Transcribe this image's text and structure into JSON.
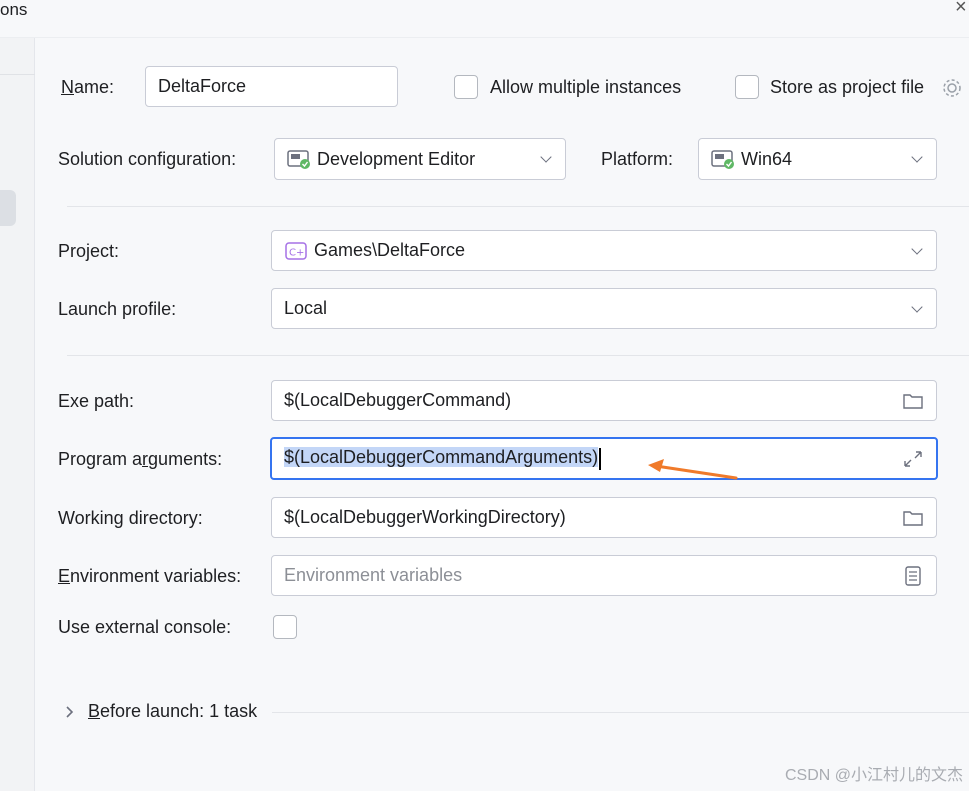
{
  "window": {
    "title_fragment": "ons"
  },
  "name": {
    "label": "Name:",
    "value": "DeltaForce"
  },
  "allow_multiple": {
    "label": "Allow multiple instances",
    "checked": false
  },
  "store_project": {
    "label": "Store as project file",
    "checked": false
  },
  "solution_config": {
    "label": "Solution configuration:",
    "value": "Development Editor"
  },
  "platform": {
    "label": "Platform:",
    "value": "Win64"
  },
  "project": {
    "label": "Project:",
    "value": "Games\\DeltaForce"
  },
  "launch_profile": {
    "label": "Launch profile:",
    "value": "Local"
  },
  "exe_path": {
    "label": "Exe path:",
    "value": "$(LocalDebuggerCommand)"
  },
  "program_args": {
    "label": "Program arguments:",
    "value": "$(LocalDebuggerCommandArguments)"
  },
  "working_dir": {
    "label": "Working directory:",
    "value": "$(LocalDebuggerWorkingDirectory)"
  },
  "env_vars": {
    "label": "Environment variables:",
    "placeholder": "Environment variables"
  },
  "external_console": {
    "label": "Use external console:",
    "checked": false
  },
  "before_launch": {
    "label": "Before launch: 1 task"
  },
  "watermark": "CSDN @小江村儿的文杰",
  "colors": {
    "accent": "#3574f0",
    "arrow": "#f07a2a",
    "selection": "#c3d6f7"
  }
}
